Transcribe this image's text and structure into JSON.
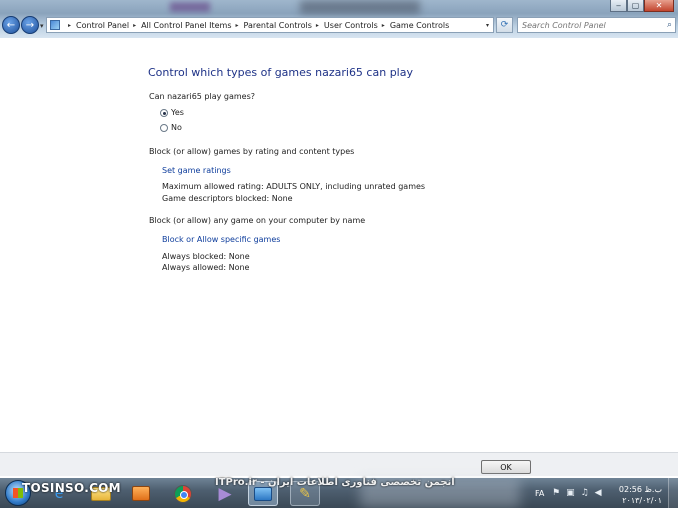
{
  "window": {
    "controls": {
      "minimize": "‒",
      "maximize": "▢",
      "close": "✕"
    }
  },
  "nav": {
    "back_icon": "←",
    "forward_icon": "→",
    "dropdown_icon": "▾"
  },
  "address": {
    "breadcrumbs": [
      "Control Panel",
      "All Control Panel Items",
      "Parental Controls",
      "User Controls",
      "Game Controls"
    ],
    "refresh_icon": "⟳"
  },
  "search": {
    "placeholder": "Search Control Panel",
    "icon": "⌕"
  },
  "content": {
    "heading": "Control which types of games nazari65 can play",
    "question": "Can nazari65 play games?",
    "options": [
      {
        "label": "Yes",
        "selected": true
      },
      {
        "label": "No",
        "selected": false
      }
    ],
    "section_rating": "Block (or allow) games by rating and content types",
    "set_ratings_link": "Set game ratings",
    "max_rating": "Maximum allowed rating:  ADULTS ONLY, including unrated games",
    "descriptors_blocked": "Game descriptors blocked:  None",
    "section_specific": "Block (or allow) any game on your computer by name",
    "specific_link": "Block or Allow specific games",
    "always_blocked": "Always blocked:  None",
    "always_allowed": "Always allowed:  None"
  },
  "footer": {
    "ok_label": "OK"
  },
  "taskbar": {
    "watermark_left": "TOSINSO.COM",
    "watermark_center": "ITPro.ir - انجمن تخصصی فناوری اطلاعات ایران",
    "language": "FA",
    "clock_time": "02:56 ب.ظ",
    "clock_date": "۲۰۱۳/۰۲/۰۱",
    "tray_icons": [
      "flag-icon",
      "network-icon",
      "speaker-icon",
      "volume-icon"
    ]
  },
  "colors": {
    "heading": "#1e3287",
    "link": "#0e3d9c",
    "taskbar": "#4e5f70"
  }
}
